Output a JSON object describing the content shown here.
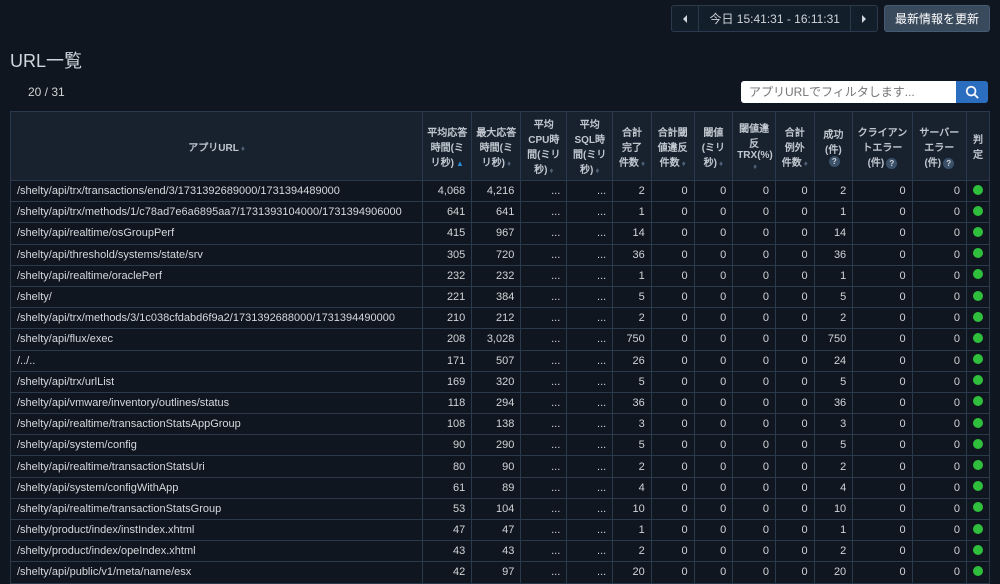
{
  "time_range": "今日 15:41:31 - 16:11:31",
  "refresh_label": "最新情報を更新",
  "section_title": "URL一覧",
  "pager": "20 / 31",
  "filter_placeholder": "アプリURLでフィルタします...",
  "columns": [
    "アプリURL",
    "平均応答時間(ミリ秒)",
    "最大応答時間(ミリ秒)",
    "平均CPU時間(ミリ秒)",
    "平均SQL時間(ミリ秒)",
    "合計完了件数",
    "合計閾値違反件数",
    "閾値(ミリ秒)",
    "閾値違反TRX(%)",
    "合計例外件数",
    "成功(件)",
    "クライアントエラー(件)",
    "サーバーエラー(件)",
    "判定"
  ],
  "rows": [
    {
      "url": "/shelty/api/trx/transactions/end/3/1731392689000/1731394489000",
      "avg": "4,068",
      "max": "4,216",
      "cpu": "...",
      "sql": "...",
      "done": "2",
      "viol": "0",
      "thr": "0",
      "pct": "0",
      "ex": "0",
      "ok": "2",
      "ce": "0",
      "se": "0"
    },
    {
      "url": "/shelty/api/trx/methods/1/c78ad7e6a6895aa7/1731393104000/1731394906000",
      "avg": "641",
      "max": "641",
      "cpu": "...",
      "sql": "...",
      "done": "1",
      "viol": "0",
      "thr": "0",
      "pct": "0",
      "ex": "0",
      "ok": "1",
      "ce": "0",
      "se": "0"
    },
    {
      "url": "/shelty/api/realtime/osGroupPerf",
      "avg": "415",
      "max": "967",
      "cpu": "...",
      "sql": "...",
      "done": "14",
      "viol": "0",
      "thr": "0",
      "pct": "0",
      "ex": "0",
      "ok": "14",
      "ce": "0",
      "se": "0"
    },
    {
      "url": "/shelty/api/threshold/systems/state/srv",
      "avg": "305",
      "max": "720",
      "cpu": "...",
      "sql": "...",
      "done": "36",
      "viol": "0",
      "thr": "0",
      "pct": "0",
      "ex": "0",
      "ok": "36",
      "ce": "0",
      "se": "0"
    },
    {
      "url": "/shelty/api/realtime/oraclePerf",
      "avg": "232",
      "max": "232",
      "cpu": "...",
      "sql": "...",
      "done": "1",
      "viol": "0",
      "thr": "0",
      "pct": "0",
      "ex": "0",
      "ok": "1",
      "ce": "0",
      "se": "0"
    },
    {
      "url": "/shelty/",
      "avg": "221",
      "max": "384",
      "cpu": "...",
      "sql": "...",
      "done": "5",
      "viol": "0",
      "thr": "0",
      "pct": "0",
      "ex": "0",
      "ok": "5",
      "ce": "0",
      "se": "0"
    },
    {
      "url": "/shelty/api/trx/methods/3/1c038cfdabd6f9a2/1731392688000/1731394490000",
      "avg": "210",
      "max": "212",
      "cpu": "...",
      "sql": "...",
      "done": "2",
      "viol": "0",
      "thr": "0",
      "pct": "0",
      "ex": "0",
      "ok": "2",
      "ce": "0",
      "se": "0"
    },
    {
      "url": "/shelty/api/flux/exec",
      "avg": "208",
      "max": "3,028",
      "cpu": "...",
      "sql": "...",
      "done": "750",
      "viol": "0",
      "thr": "0",
      "pct": "0",
      "ex": "0",
      "ok": "750",
      "ce": "0",
      "se": "0"
    },
    {
      "url": "/../..",
      "avg": "171",
      "max": "507",
      "cpu": "...",
      "sql": "...",
      "done": "26",
      "viol": "0",
      "thr": "0",
      "pct": "0",
      "ex": "0",
      "ok": "24",
      "ce": "0",
      "se": "0"
    },
    {
      "url": "/shelty/api/trx/urlList",
      "avg": "169",
      "max": "320",
      "cpu": "...",
      "sql": "...",
      "done": "5",
      "viol": "0",
      "thr": "0",
      "pct": "0",
      "ex": "0",
      "ok": "5",
      "ce": "0",
      "se": "0"
    },
    {
      "url": "/shelty/api/vmware/inventory/outlines/status",
      "avg": "118",
      "max": "294",
      "cpu": "...",
      "sql": "...",
      "done": "36",
      "viol": "0",
      "thr": "0",
      "pct": "0",
      "ex": "0",
      "ok": "36",
      "ce": "0",
      "se": "0"
    },
    {
      "url": "/shelty/api/realtime/transactionStatsAppGroup",
      "avg": "108",
      "max": "138",
      "cpu": "...",
      "sql": "...",
      "done": "3",
      "viol": "0",
      "thr": "0",
      "pct": "0",
      "ex": "0",
      "ok": "3",
      "ce": "0",
      "se": "0"
    },
    {
      "url": "/shelty/api/system/config",
      "avg": "90",
      "max": "290",
      "cpu": "...",
      "sql": "...",
      "done": "5",
      "viol": "0",
      "thr": "0",
      "pct": "0",
      "ex": "0",
      "ok": "5",
      "ce": "0",
      "se": "0"
    },
    {
      "url": "/shelty/api/realtime/transactionStatsUri",
      "avg": "80",
      "max": "90",
      "cpu": "...",
      "sql": "...",
      "done": "2",
      "viol": "0",
      "thr": "0",
      "pct": "0",
      "ex": "0",
      "ok": "2",
      "ce": "0",
      "se": "0"
    },
    {
      "url": "/shelty/api/system/configWithApp",
      "avg": "61",
      "max": "89",
      "cpu": "...",
      "sql": "...",
      "done": "4",
      "viol": "0",
      "thr": "0",
      "pct": "0",
      "ex": "0",
      "ok": "4",
      "ce": "0",
      "se": "0"
    },
    {
      "url": "/shelty/api/realtime/transactionStatsGroup",
      "avg": "53",
      "max": "104",
      "cpu": "...",
      "sql": "...",
      "done": "10",
      "viol": "0",
      "thr": "0",
      "pct": "0",
      "ex": "0",
      "ok": "10",
      "ce": "0",
      "se": "0"
    },
    {
      "url": "/shelty/product/index/instIndex.xhtml",
      "avg": "47",
      "max": "47",
      "cpu": "...",
      "sql": "...",
      "done": "1",
      "viol": "0",
      "thr": "0",
      "pct": "0",
      "ex": "0",
      "ok": "1",
      "ce": "0",
      "se": "0"
    },
    {
      "url": "/shelty/product/index/opeIndex.xhtml",
      "avg": "43",
      "max": "43",
      "cpu": "...",
      "sql": "...",
      "done": "2",
      "viol": "0",
      "thr": "0",
      "pct": "0",
      "ex": "0",
      "ok": "2",
      "ce": "0",
      "se": "0"
    },
    {
      "url": "/shelty/api/public/v1/meta/name/esx",
      "avg": "42",
      "max": "97",
      "cpu": "...",
      "sql": "...",
      "done": "20",
      "viol": "0",
      "thr": "0",
      "pct": "0",
      "ex": "0",
      "ok": "20",
      "ce": "0",
      "se": "0"
    }
  ]
}
